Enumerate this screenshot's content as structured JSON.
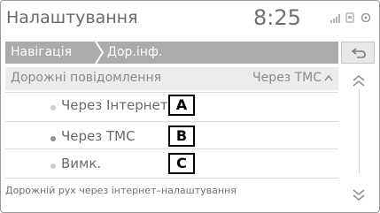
{
  "header": {
    "title": "Налаштування",
    "time": "8:25",
    "status_icons": [
      "signal-icon",
      "phone-icon",
      "battery-icon"
    ]
  },
  "breadcrumb": {
    "items": [
      "Навігація",
      "Дор.інф."
    ]
  },
  "back_icon": "back-arrow-icon",
  "section": {
    "title": "Дорожні повідомлення",
    "value": "Через ТМС",
    "chevron_icon": "chevron-up-icon"
  },
  "options": [
    {
      "label": "Через Інтернет",
      "selected": false,
      "callout": "A"
    },
    {
      "label": "Через ТМС",
      "selected": true,
      "callout": "B"
    },
    {
      "label": "Вимк.",
      "selected": false,
      "callout": "C"
    }
  ],
  "footer_link": "Дорожній рух через інтернет–налаштування",
  "scroll": {
    "up_icon": "scroll-up-icon",
    "down_icon": "scroll-down-icon"
  },
  "colors": {
    "breadcrumb_bg": "#ababab",
    "text": "#6a6a6a",
    "selected_dot": "#909090",
    "unselected_dot": "#cfcfcf"
  }
}
